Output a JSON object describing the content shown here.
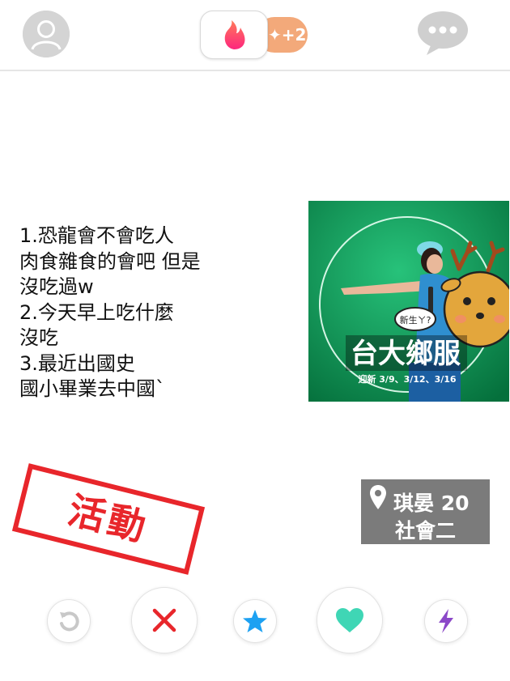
{
  "header": {
    "boost_count": "+2",
    "boost_color": "#f3a97a",
    "flame_color": "#ff5864",
    "profile_icon": "profile-icon",
    "chat_icon": "chat-bubble-icon"
  },
  "card": {
    "description_lines": [
      "1.恐龍會不會吃人",
      "肉食雜食的會吧 但是",
      "沒吃過w",
      "2.今天早上吃什麼",
      "沒吃",
      "3.最近出國史",
      "國小畢業去中國`"
    ],
    "photo": {
      "title": "台大鄉服",
      "subtitle": "迎新 3/9、3/12、3/16",
      "bubble_text": "新生ㄚ?"
    },
    "stamp_text": "活動",
    "stamp_color": "#e8262b",
    "name_age": "琪晏 20",
    "department": "社會二"
  },
  "actions": {
    "rewind": "rewind-icon",
    "nope": "x-icon",
    "super_like": "star-icon",
    "like": "heart-icon",
    "boost": "lightning-icon",
    "colors": {
      "rewind": "#c8c8c8",
      "nope": "#e8262b",
      "super_like": "#1da1f2",
      "like": "#3fd6b5",
      "boost": "#8b48c8"
    }
  }
}
